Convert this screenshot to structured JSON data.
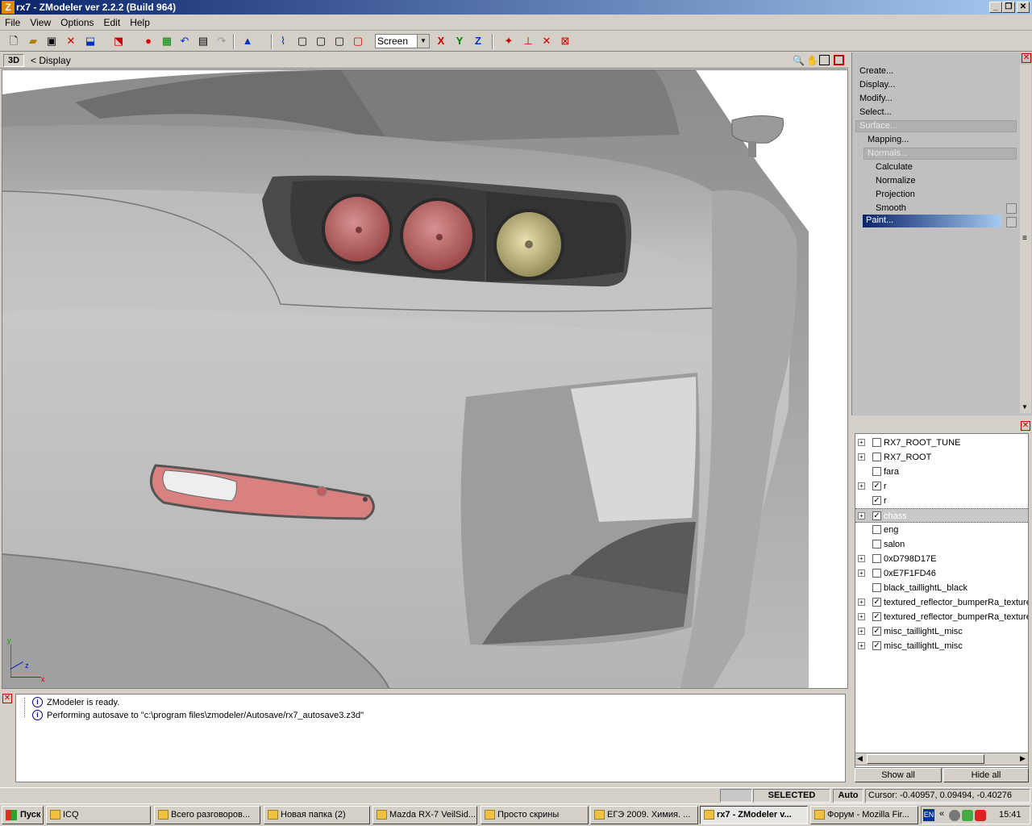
{
  "window": {
    "title": "rx7 - ZModeler ver 2.2.2 (Build 964)"
  },
  "menu": [
    "File",
    "View",
    "Options",
    "Edit",
    "Help"
  ],
  "toolbar": {
    "view_select": "Screen",
    "axis_x": "X",
    "axis_y": "Y",
    "axis_z": "Z"
  },
  "viewport": {
    "mode": "3D",
    "label": "< Display",
    "axes": {
      "y": "y",
      "z": "z",
      "x": "x"
    }
  },
  "commands": {
    "create": "Create...",
    "display": "Display...",
    "modify": "Modify...",
    "select": "Select...",
    "surface": "Surface...",
    "mapping": "Mapping...",
    "normals": "Normals...",
    "calculate": "Calculate",
    "normalize": "Normalize",
    "projection": "Projection",
    "smooth": "Smooth",
    "paint": "Paint..."
  },
  "objects": [
    {
      "name": "RX7_ROOT_TUNE",
      "checked": false,
      "expandable": true
    },
    {
      "name": "RX7_ROOT",
      "checked": false,
      "expandable": true
    },
    {
      "name": "fara",
      "checked": false,
      "expandable": false
    },
    {
      "name": "r",
      "checked": true,
      "expandable": true
    },
    {
      "name": "r",
      "checked": true,
      "expandable": false
    },
    {
      "name": "chass",
      "checked": true,
      "expandable": true,
      "selected": true
    },
    {
      "name": "eng",
      "checked": false,
      "expandable": false
    },
    {
      "name": "salon",
      "checked": false,
      "expandable": false
    },
    {
      "name": "0xD798D17E",
      "checked": false,
      "expandable": true
    },
    {
      "name": "0xE7F1FD46",
      "checked": false,
      "expandable": true
    },
    {
      "name": "black_taillightL_black",
      "checked": false,
      "expandable": false
    },
    {
      "name": "textured_reflector_bumperRa_texture",
      "checked": true,
      "expandable": true
    },
    {
      "name": "textured_reflector_bumperRa_texture",
      "checked": true,
      "expandable": true
    },
    {
      "name": "misc_taillightL_misc",
      "checked": true,
      "expandable": true
    },
    {
      "name": "misc_taillightL_misc",
      "checked": true,
      "expandable": true
    }
  ],
  "object_buttons": {
    "show_all": "Show all",
    "hide_all": "Hide all"
  },
  "log": [
    "ZModeler is ready.",
    "Performing autosave to \"c:\\program files\\zmodeler/Autosave/rx7_autosave3.z3d\""
  ],
  "status": {
    "mode": "SELECTED MODE",
    "auto": "Auto",
    "cursor": "Cursor: -0.40957, 0.09494, -0.40276"
  },
  "taskbar": {
    "start": "Пуск",
    "tasks": [
      "ICQ",
      "Всего разговоров...",
      "Новая папка (2)",
      "Mazda RX-7 VeilSid...",
      "Просто скрины",
      "ЕГЭ 2009. Химия. ...",
      "rx7 - ZModeler v...",
      "Форум - Mozilla Fir..."
    ],
    "lang": "EN",
    "clock": "15:41"
  }
}
